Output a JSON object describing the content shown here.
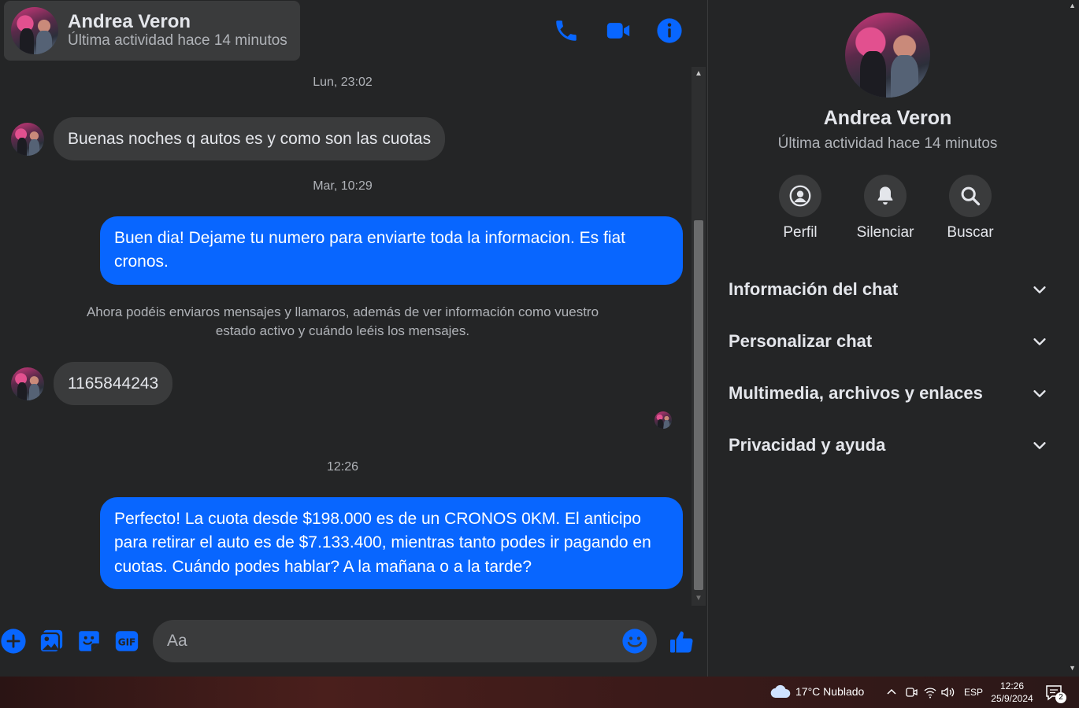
{
  "header": {
    "name": "Andrea Veron",
    "status": "Última actividad hace 14 minutos"
  },
  "messages": {
    "ts1": "Lun, 23:02",
    "in1": "Buenas noches q autos es y como son las cuotas",
    "ts2": "Mar, 10:29",
    "out1": "Buen dia! Dejame tu numero para enviarte toda la informacion. Es fiat cronos.",
    "system_note": "Ahora podéis enviaros mensajes y llamaros, además de ver información como vuestro estado activo y cuándo leéis los mensajes.",
    "in2": "1165844243",
    "ts3": "12:26",
    "out2": "Perfecto! La cuota desde $198.000 es de un CRONOS 0KM. El anticipo para retirar el auto es de $7.133.400, mientras tanto podes ir pagando en cuotas. Cuándo podes hablar? A la mañana o a la tarde?"
  },
  "composer": {
    "placeholder": "Aa"
  },
  "info": {
    "name": "Andrea Veron",
    "status": "Última actividad hace 14 minutos",
    "actions": [
      {
        "label": "Perfil"
      },
      {
        "label": "Silenciar"
      },
      {
        "label": "Buscar"
      }
    ],
    "sections": [
      {
        "label": "Información del chat"
      },
      {
        "label": "Personalizar chat"
      },
      {
        "label": "Multimedia, archivos y enlaces"
      },
      {
        "label": "Privacidad y ayuda"
      }
    ]
  },
  "taskbar": {
    "weather": "17°C  Nublado",
    "lang": "ESP",
    "time": "12:26",
    "date": "25/9/2024",
    "notifications": "2"
  },
  "colors": {
    "accent": "#0866ff",
    "background": "#242526",
    "surface": "#3a3b3c"
  }
}
